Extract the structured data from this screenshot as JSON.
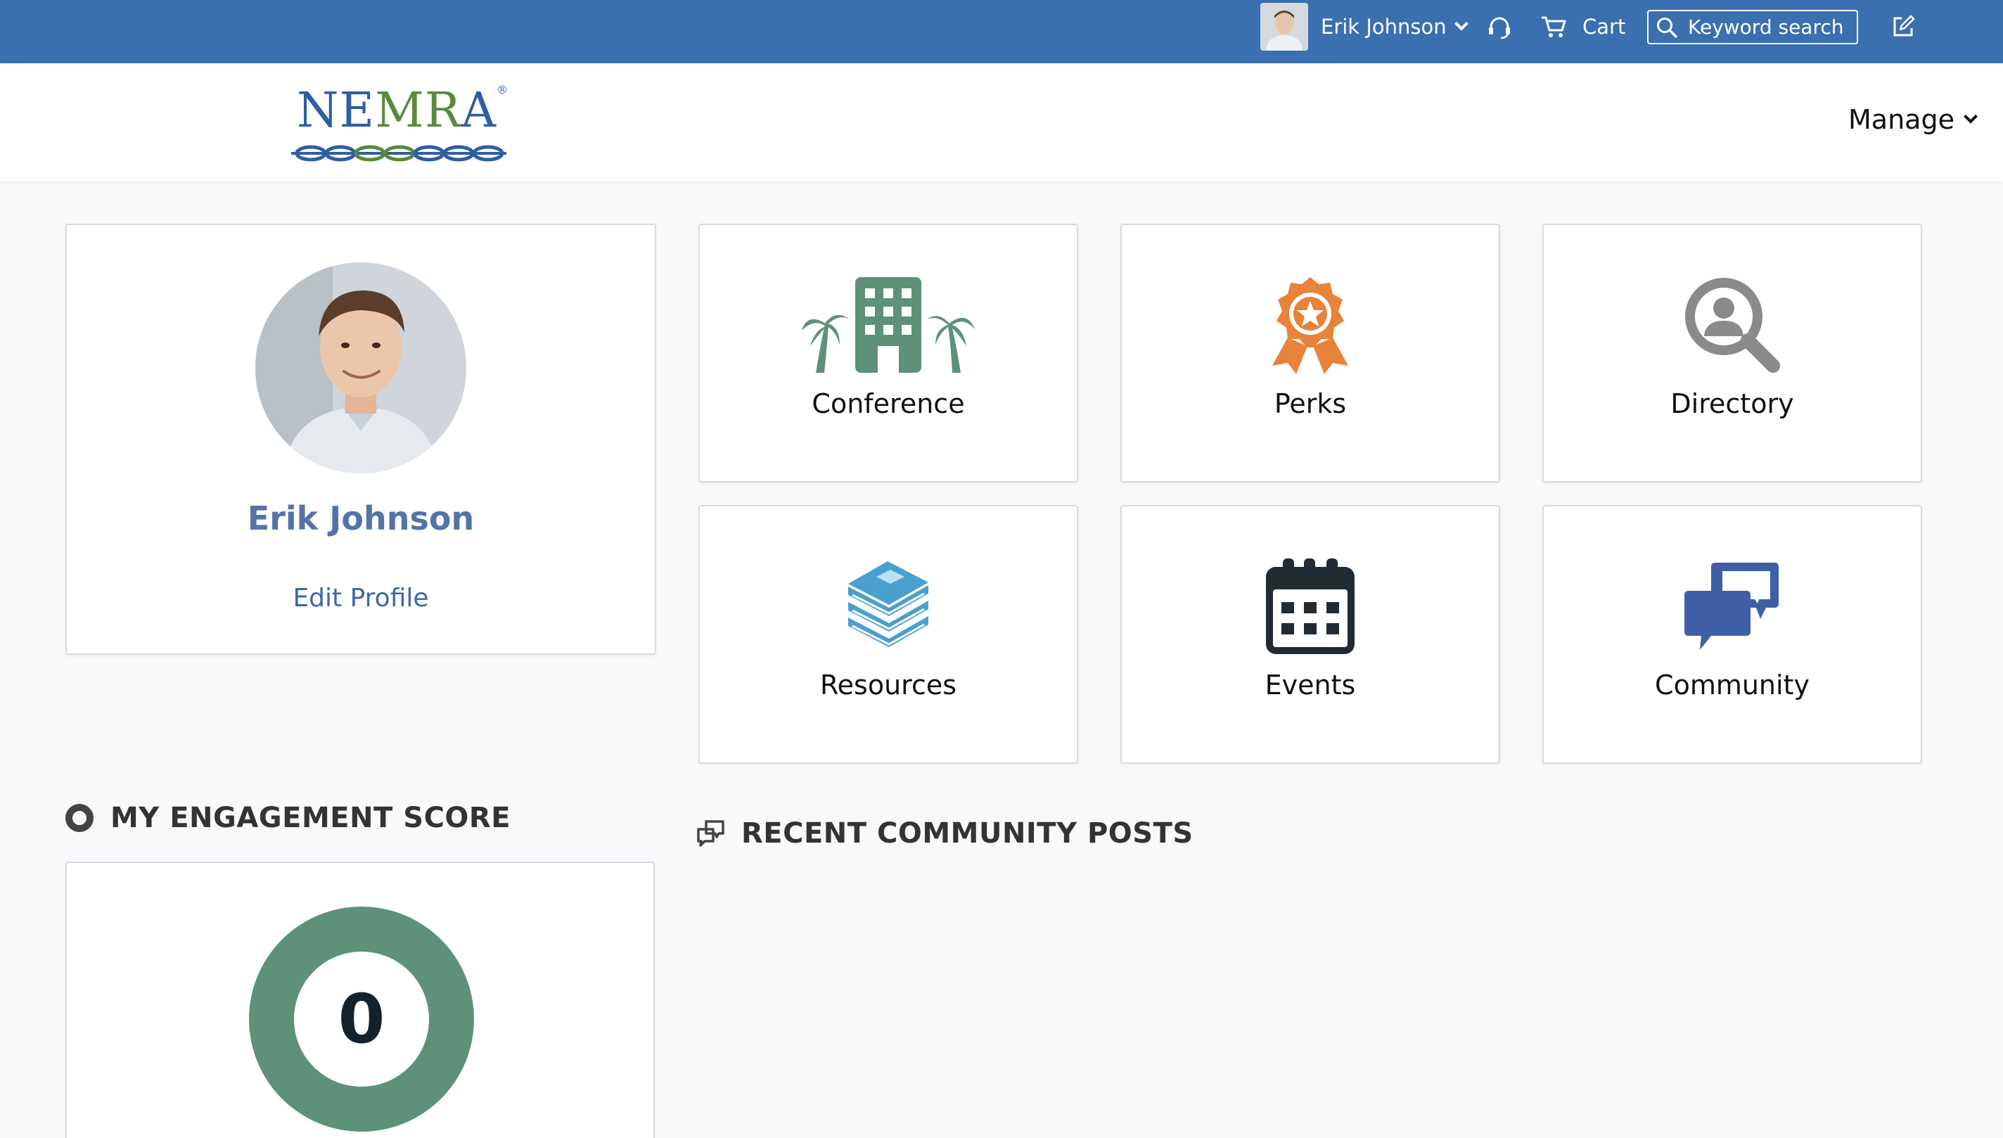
{
  "topbar": {
    "user_name": "Erik Johnson",
    "cart_label": "Cart",
    "search_label": "Keyword search",
    "icons": [
      "avatar",
      "chevron-down-icon",
      "headset-icon",
      "cart-icon",
      "search-icon",
      "edit-icon"
    ]
  },
  "header": {
    "logo_text": "NEMRA",
    "logo_mark": "®",
    "manage_label": "Manage"
  },
  "profile": {
    "name": "Erik Johnson",
    "edit_label": "Edit Profile"
  },
  "tiles": [
    {
      "label": "Conference",
      "icon": "building-palms-icon",
      "color": "#5e917a"
    },
    {
      "label": "Perks",
      "icon": "award-icon",
      "color": "#e8833a"
    },
    {
      "label": "Directory",
      "icon": "user-search-icon",
      "color": "#8a8a8a"
    },
    {
      "label": "Resources",
      "icon": "book-stack-icon",
      "color": "#4a9fd0"
    },
    {
      "label": "Events",
      "icon": "calendar-icon",
      "color": "#222a33"
    },
    {
      "label": "Community",
      "icon": "chat-bubbles-icon",
      "color": "#3e5fa6"
    }
  ],
  "engagement": {
    "title": "MY ENGAGEMENT SCORE",
    "score": "0"
  },
  "posts": {
    "title": "RECENT COMMUNITY POSTS"
  },
  "colors": {
    "topbar": "#3b6fb0",
    "accent": "#5573a8",
    "donut": "#5e917a"
  }
}
